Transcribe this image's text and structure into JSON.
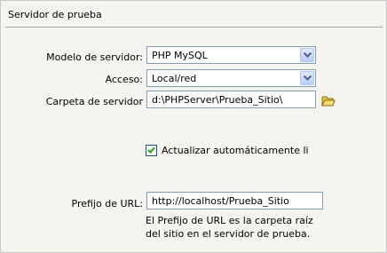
{
  "section": {
    "title": "Servidor de prueba"
  },
  "form": {
    "server_model": {
      "label": "Modelo de servidor:",
      "value": "PHP MySQL"
    },
    "access": {
      "label": "Acceso:",
      "value": "Local/red"
    },
    "server_folder": {
      "label": "Carpeta de servidor",
      "value": "d:\\PHPServer\\Prueba_Sitio\\"
    },
    "auto_refresh": {
      "label": "Actualizar automáticamente lista de",
      "checked": true
    },
    "url_prefix": {
      "label": "Prefijo de URL:",
      "value": "http://localhost/Prueba_Sitio"
    },
    "help_text": "El Prefijo de URL es la carpeta raíz del sitio en el servidor de prueba."
  },
  "colors": {
    "panel_bg": "#f5f4ee",
    "field_border": "#7f9db9",
    "check_mark": "#21a121"
  },
  "icons": [
    "chevron-down-icon",
    "folder-icon",
    "checkmark-icon"
  ]
}
